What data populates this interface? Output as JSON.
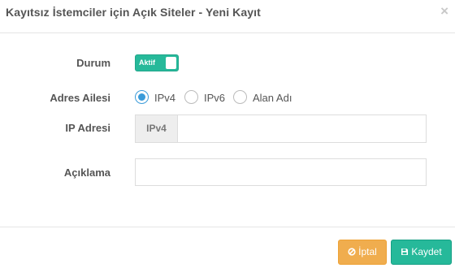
{
  "modal": {
    "title": "Kayıtsız İstemciler için Açık Siteler - Yeni Kayıt",
    "close_symbol": "×"
  },
  "form": {
    "status": {
      "label": "Durum",
      "toggle_text": "Aktif",
      "enabled": true
    },
    "address_family": {
      "label": "Adres Ailesi",
      "options": [
        {
          "label": "IPv4",
          "selected": true
        },
        {
          "label": "IPv6",
          "selected": false
        },
        {
          "label": "Alan Adı",
          "selected": false
        }
      ]
    },
    "ip_address": {
      "label": "IP Adresi",
      "addon": "IPv4",
      "value": ""
    },
    "description": {
      "label": "Açıklama",
      "value": ""
    }
  },
  "footer": {
    "cancel_label": "İptal",
    "cancel_icon": "ban-icon",
    "save_label": "Kaydet",
    "save_icon": "floppy-disk-icon"
  },
  "colors": {
    "primary_green": "#26b99a",
    "cancel_orange": "#f0ad4e",
    "radio_blue": "#3a9bd9"
  }
}
